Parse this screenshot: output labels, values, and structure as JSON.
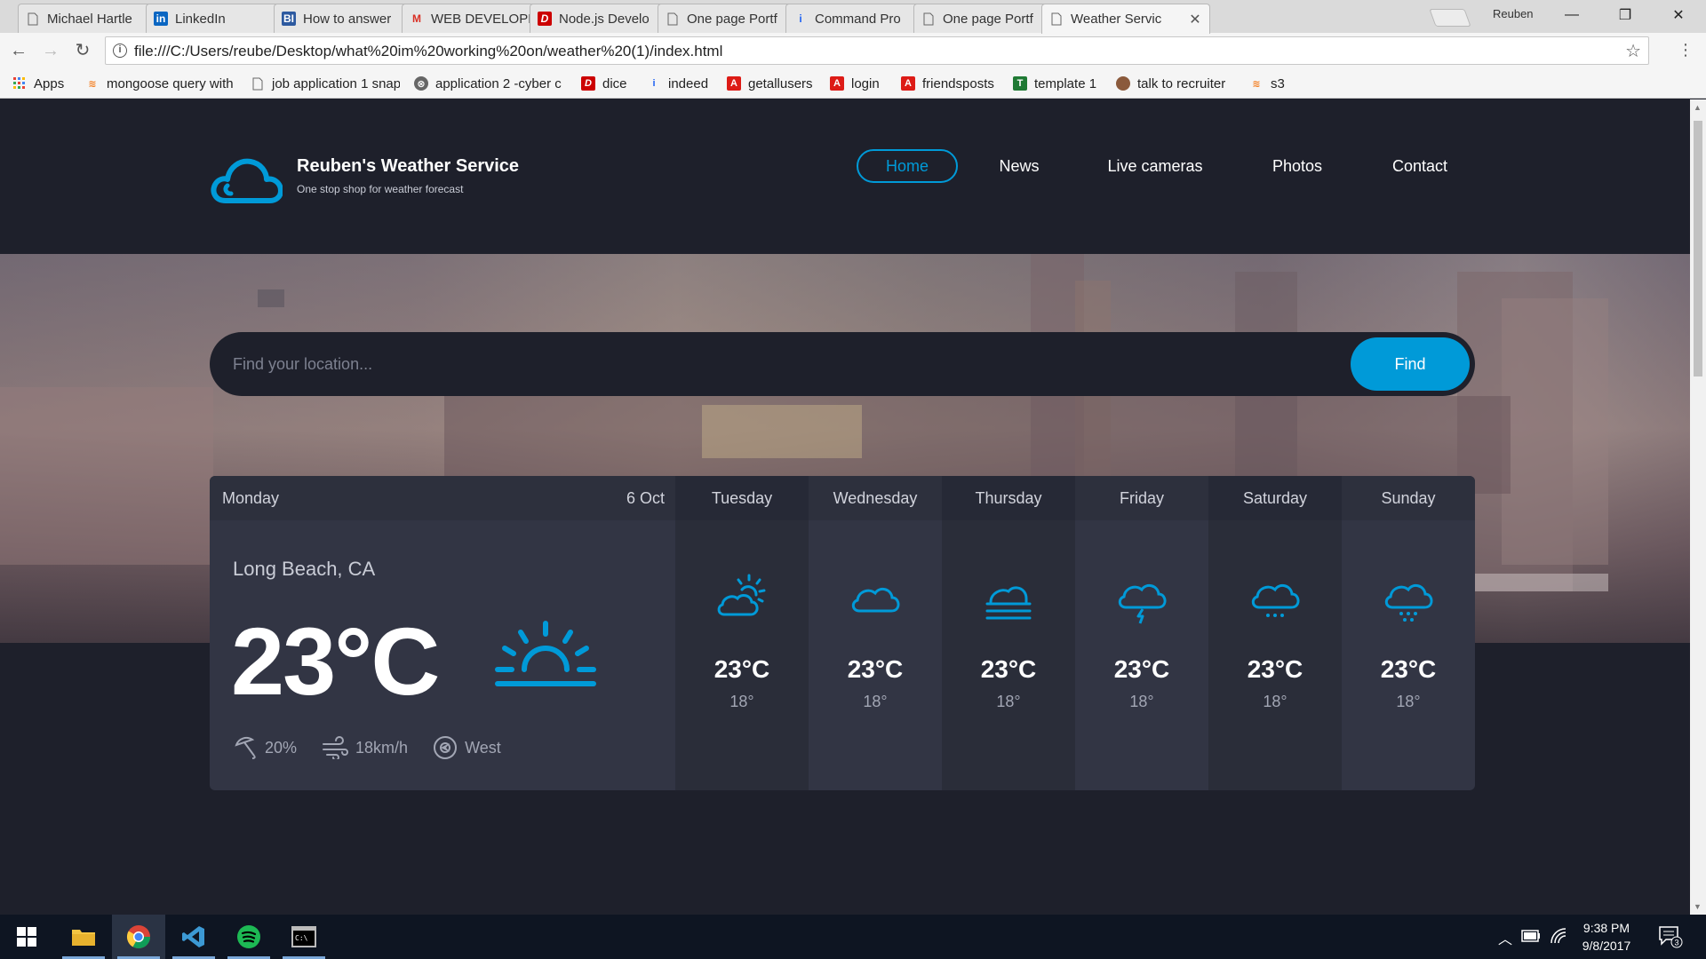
{
  "browser": {
    "tabs": [
      {
        "title": "Michael Hartle",
        "icon": "page-icon"
      },
      {
        "title": "LinkedIn",
        "icon": "linkedin-icon"
      },
      {
        "title": "How to answer",
        "icon": "bi-icon"
      },
      {
        "title": "WEB DEVELOPE",
        "icon": "gmail-icon"
      },
      {
        "title": "Node.js Develo",
        "icon": "dice-icon"
      },
      {
        "title": "One page Portf",
        "icon": "page-icon"
      },
      {
        "title": "Command Pro",
        "icon": "indeed-icon"
      },
      {
        "title": "One page Portf",
        "icon": "page-icon"
      },
      {
        "title": "Weather Servic",
        "icon": "page-icon"
      }
    ],
    "profile_name": "Reuben",
    "url": "file:///C:/Users/reube/Desktop/what%20im%20working%20on/weather%20(1)/index.html",
    "bookmarks": [
      {
        "label": "Apps",
        "icon": "apps-grid-icon",
        "color": "#e94235"
      },
      {
        "label": "mongoose query with",
        "icon": "stack-icon",
        "color": "#f48024"
      },
      {
        "label": "job application 1 snap",
        "icon": "page-icon",
        "color": "#777777"
      },
      {
        "label": "application 2 -cyber c",
        "icon": "cyber-icon",
        "color": "#555555"
      },
      {
        "label": "dice",
        "icon": "dice-icon",
        "color": "#cc0000"
      },
      {
        "label": "indeed",
        "icon": "indeed-icon",
        "color": "#2164f3"
      },
      {
        "label": "getallusers",
        "icon": "angular-icon",
        "color": "#dd1b16"
      },
      {
        "label": "login",
        "icon": "angular-icon",
        "color": "#dd1b16"
      },
      {
        "label": "friendsposts",
        "icon": "angular-icon",
        "color": "#dd1b16"
      },
      {
        "label": "template 1",
        "icon": "template-icon",
        "color": "#1f7a34"
      },
      {
        "label": "talk to recruiter",
        "icon": "avatar-icon",
        "color": "#8b5a3c"
      },
      {
        "label": "s3",
        "icon": "stack-icon",
        "color": "#f48024"
      }
    ]
  },
  "site": {
    "brand_title": "Reuben's Weather Service",
    "brand_tagline": "One stop shop for weather forecast",
    "nav": [
      "Home",
      "News",
      "Live cameras",
      "Photos",
      "Contact"
    ],
    "active_nav": "Home",
    "accent_color": "#009ad8",
    "search_placeholder": "Find your location...",
    "find_label": "Find"
  },
  "today": {
    "day": "Monday",
    "date": "6 Oct",
    "location": "Long Beach, CA",
    "temperature": "23°C",
    "icon": "sunrise-icon",
    "humidity": "20%",
    "wind_speed": "18km/h",
    "wind_direction": "West"
  },
  "forecast": [
    {
      "day": "Tuesday",
      "high": "23°C",
      "low": "18°",
      "icon": "partly-cloudy-icon"
    },
    {
      "day": "Wednesday",
      "high": "23°C",
      "low": "18°",
      "icon": "cloud-icon"
    },
    {
      "day": "Thursday",
      "high": "23°C",
      "low": "18°",
      "icon": "fog-icon"
    },
    {
      "day": "Friday",
      "high": "23°C",
      "low": "18°",
      "icon": "thunder-icon"
    },
    {
      "day": "Saturday",
      "high": "23°C",
      "low": "18°",
      "icon": "rain-icon"
    },
    {
      "day": "Sunday",
      "high": "23°C",
      "low": "18°",
      "icon": "snow-icon"
    }
  ],
  "taskbar": {
    "apps": [
      "windows-start-icon",
      "file-explorer-icon",
      "chrome-icon",
      "vscode-icon",
      "spotify-icon",
      "terminal-icon"
    ],
    "time": "9:38 PM",
    "date": "9/8/2017",
    "notification_count": "3"
  }
}
